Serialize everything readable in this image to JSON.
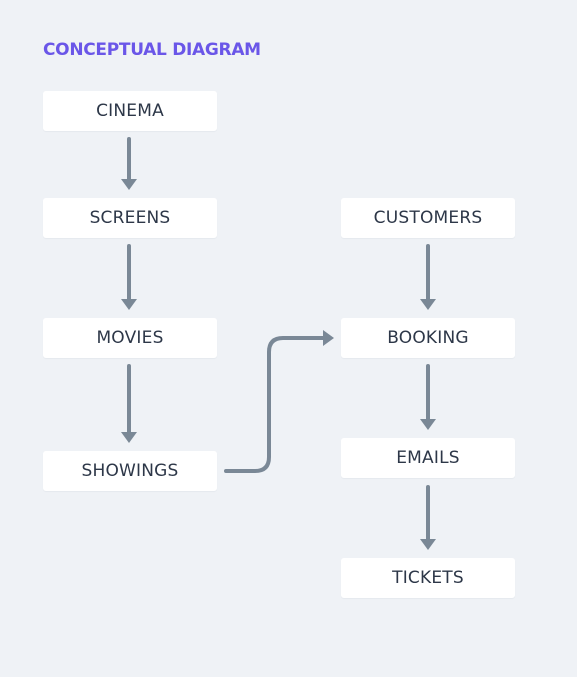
{
  "title": "CONCEPTUAL DIAGRAM",
  "nodes": {
    "cinema": "CINEMA",
    "screens": "SCREENS",
    "movies": "MOVIES",
    "showings": "SHOWINGS",
    "customers": "CUSTOMERS",
    "booking": "BOOKING",
    "emails": "EMAILS",
    "tickets": "TICKETS"
  },
  "colors": {
    "title": "#6a56e8",
    "arrow": "#7a8896",
    "node_bg": "#ffffff",
    "node_text": "#2d3748",
    "background": "#eff2f6"
  }
}
